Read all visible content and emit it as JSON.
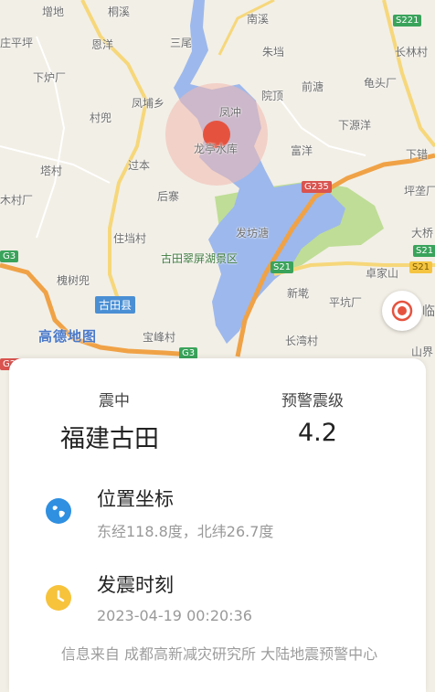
{
  "map": {
    "labels": {
      "zengdi": "增地",
      "heyang": "桐溪",
      "nanxi": "南溪",
      "zhuangping": "庄平坪",
      "sanwei": "三尾",
      "enyang": "恩洋",
      "zhudang": "朱垱",
      "changlin": "长林村",
      "xialuchang": "下炉厂",
      "fengpu": "凤埔乡",
      "yuanding": "院顶",
      "qiantang": "前溏",
      "guijiaochang": "龟头厂",
      "cunnei": "村兜",
      "fengchong": "凤冲",
      "xiayuanyang": "下源洋",
      "longting": "龙亭水库",
      "fuyang": "富洋",
      "buting": "下错",
      "tacun": "塔村",
      "guoben": "过本",
      "houzhai": "后寨",
      "pingcha": "坪垄厂",
      "mucun": "木村厂",
      "fangzhou": "发坊溏",
      "dayuan": "大桥",
      "zhuangzhuang": "住垱村",
      "scenic": "古田翠屏湖景区",
      "zhuyangcun": "槐树兜",
      "xinzhai": "新墘",
      "pingkeng": "卓家山",
      "ping2": "平坑厂",
      "gutian": "古田县",
      "baolong": "宝峰村",
      "changwan": "长湾村",
      "shanshi": "山界",
      "lin": "临"
    },
    "shields": {
      "s221": "S221",
      "g235": "G235",
      "g3a": "G3",
      "s21a": "S21",
      "s21b": "S21",
      "g3b": "G3",
      "s21c": "S21",
      "g235b": "G235"
    },
    "logo": "高德地图",
    "colors": {
      "water": "#9db8ec",
      "green": "#bfdd96",
      "road_orange": "#f0a246",
      "road_yellow": "#f6d77a",
      "epicenter": "#e5533f"
    }
  },
  "card": {
    "epicenter_header": "震中",
    "epicenter_value": "福建古田",
    "magnitude_header": "预警震级",
    "magnitude_value": "4.2",
    "location_title": "位置坐标",
    "location_value": "东经118.8度，北纬26.7度",
    "time_title": "发震时刻",
    "time_value": "2023-04-19 00:20:36",
    "footer": "信息来自 成都高新减灾研究所 大陆地震预警中心"
  },
  "icons": {
    "globe": "globe-icon",
    "clock": "clock-icon",
    "locate": "locate-icon"
  }
}
